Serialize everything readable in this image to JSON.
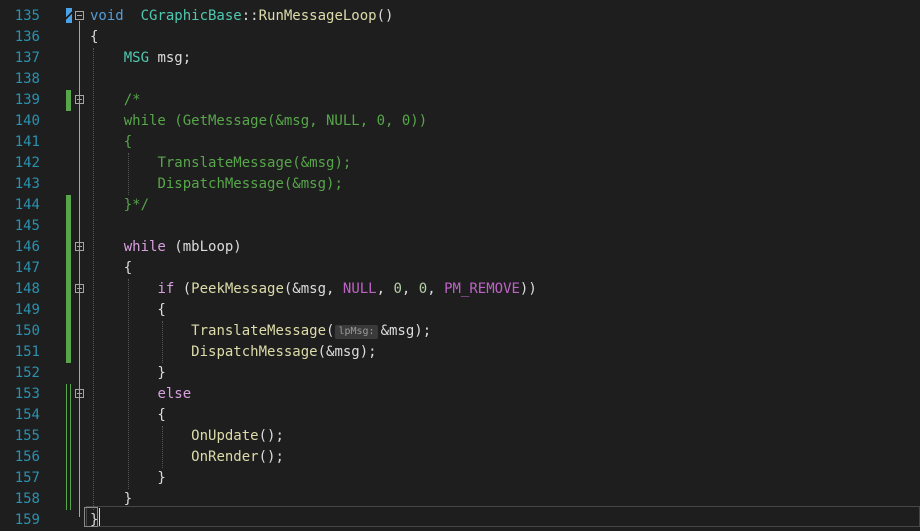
{
  "editor": {
    "line_numbers": [
      "135",
      "136",
      "137",
      "138",
      "139",
      "140",
      "141",
      "142",
      "143",
      "144",
      "145",
      "146",
      "147",
      "148",
      "149",
      "150",
      "151",
      "152",
      "153",
      "154",
      "155",
      "156",
      "157",
      "158",
      "159"
    ],
    "lines": [
      [
        [
          "kw",
          "void"
        ],
        [
          "",
          "  "
        ],
        [
          "cls",
          "CGraphicBase"
        ],
        [
          "",
          "::"
        ],
        [
          "fn",
          "RunMessageLoop"
        ],
        [
          "",
          "()"
        ]
      ],
      [
        [
          "",
          "{"
        ]
      ],
      [
        [
          "",
          "    "
        ],
        [
          "cls",
          "MSG"
        ],
        [
          "",
          " msg;"
        ]
      ],
      [],
      [
        [
          "",
          "    "
        ],
        [
          "cmt",
          "/*"
        ]
      ],
      [
        [
          "",
          "    "
        ],
        [
          "cmt",
          "while (GetMessage(&msg, NULL, 0, 0))"
        ]
      ],
      [
        [
          "",
          "    "
        ],
        [
          "cmt",
          "{"
        ]
      ],
      [
        [
          "",
          "        "
        ],
        [
          "cmt",
          "TranslateMessage(&msg);"
        ]
      ],
      [
        [
          "",
          "        "
        ],
        [
          "cmt",
          "DispatchMessage(&msg);"
        ]
      ],
      [
        [
          "",
          "    "
        ],
        [
          "cmt",
          "}*/"
        ]
      ],
      [],
      [
        [
          "",
          "    "
        ],
        [
          "kw2",
          "while"
        ],
        [
          "",
          " (mbLoop)"
        ]
      ],
      [
        [
          "",
          "    {"
        ]
      ],
      [
        [
          "",
          "        "
        ],
        [
          "kw2",
          "if"
        ],
        [
          "",
          " ("
        ],
        [
          "fn",
          "PeekMessage"
        ],
        [
          "",
          "(&msg, "
        ],
        [
          "mac",
          "NULL"
        ],
        [
          "",
          ", "
        ],
        [
          "num",
          "0"
        ],
        [
          "",
          ", "
        ],
        [
          "num",
          "0"
        ],
        [
          "",
          ", "
        ],
        [
          "mac",
          "PM_REMOVE"
        ],
        [
          "",
          "))"
        ]
      ],
      [
        [
          "",
          "        {"
        ]
      ],
      [
        [
          "",
          "            "
        ],
        [
          "fn",
          "TranslateMessage"
        ],
        [
          "",
          "("
        ],
        [
          "hint",
          "lpMsg:"
        ],
        [
          "",
          "&msg);"
        ]
      ],
      [
        [
          "",
          "            "
        ],
        [
          "fn",
          "DispatchMessage"
        ],
        [
          "",
          "(&msg);"
        ]
      ],
      [
        [
          "",
          "        }"
        ]
      ],
      [
        [
          "",
          "        "
        ],
        [
          "kw2",
          "else"
        ]
      ],
      [
        [
          "",
          "        {"
        ]
      ],
      [
        [
          "",
          "            "
        ],
        [
          "fn",
          "OnUpdate"
        ],
        [
          "",
          "();"
        ]
      ],
      [
        [
          "",
          "            "
        ],
        [
          "fn",
          "OnRender"
        ],
        [
          "",
          "();"
        ]
      ],
      [
        [
          "",
          "        }"
        ]
      ],
      [
        [
          "",
          "    }"
        ]
      ],
      [
        [
          "",
          "}"
        ]
      ]
    ],
    "change_markers": [
      "none",
      "none",
      "none",
      "none",
      "saved",
      "none",
      "none",
      "none",
      "none",
      "saved",
      "saved",
      "saved",
      "saved",
      "saved",
      "saved",
      "saved",
      "saved",
      "none",
      "unsaved",
      "unsaved",
      "unsaved",
      "unsaved",
      "unsaved",
      "unsaved",
      "none"
    ],
    "fold_lines": [
      "135",
      "139",
      "146",
      "148",
      "153"
    ]
  }
}
